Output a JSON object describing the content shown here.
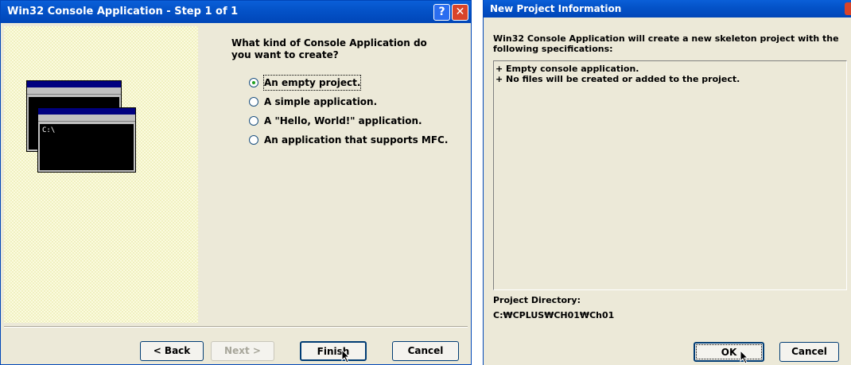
{
  "wizard": {
    "title": "Win32 Console Application - Step 1 of 1",
    "question": "What kind of Console Application do you want to create?",
    "options": [
      {
        "label": "An empty project.",
        "selected": true
      },
      {
        "label": "A simple application.",
        "selected": false
      },
      {
        "label": "A \"Hello, World!\" application.",
        "selected": false
      },
      {
        "label": "An application that supports MFC.",
        "selected": false
      }
    ],
    "illustration_prompt": "C:\\",
    "buttons": {
      "back": "< Back",
      "next": "Next >",
      "finish": "Finish",
      "cancel": "Cancel"
    }
  },
  "info": {
    "title": "New Project Information",
    "description": "Win32 Console Application will create a new skeleton project with the following specifications:",
    "spec_lines": [
      "+ Empty console application.",
      "+ No files will be created or added to the project."
    ],
    "directory_label": "Project Directory:",
    "directory_value": "C:₩CPLUS₩CH01₩Ch01",
    "buttons": {
      "ok": "OK",
      "cancel": "Cancel"
    }
  },
  "colors": {
    "titlebar": "#0453c9",
    "dialog_bg": "#ece9d8",
    "close_button": "#d9442a",
    "left_panel_pattern": "#f5f5c8"
  }
}
